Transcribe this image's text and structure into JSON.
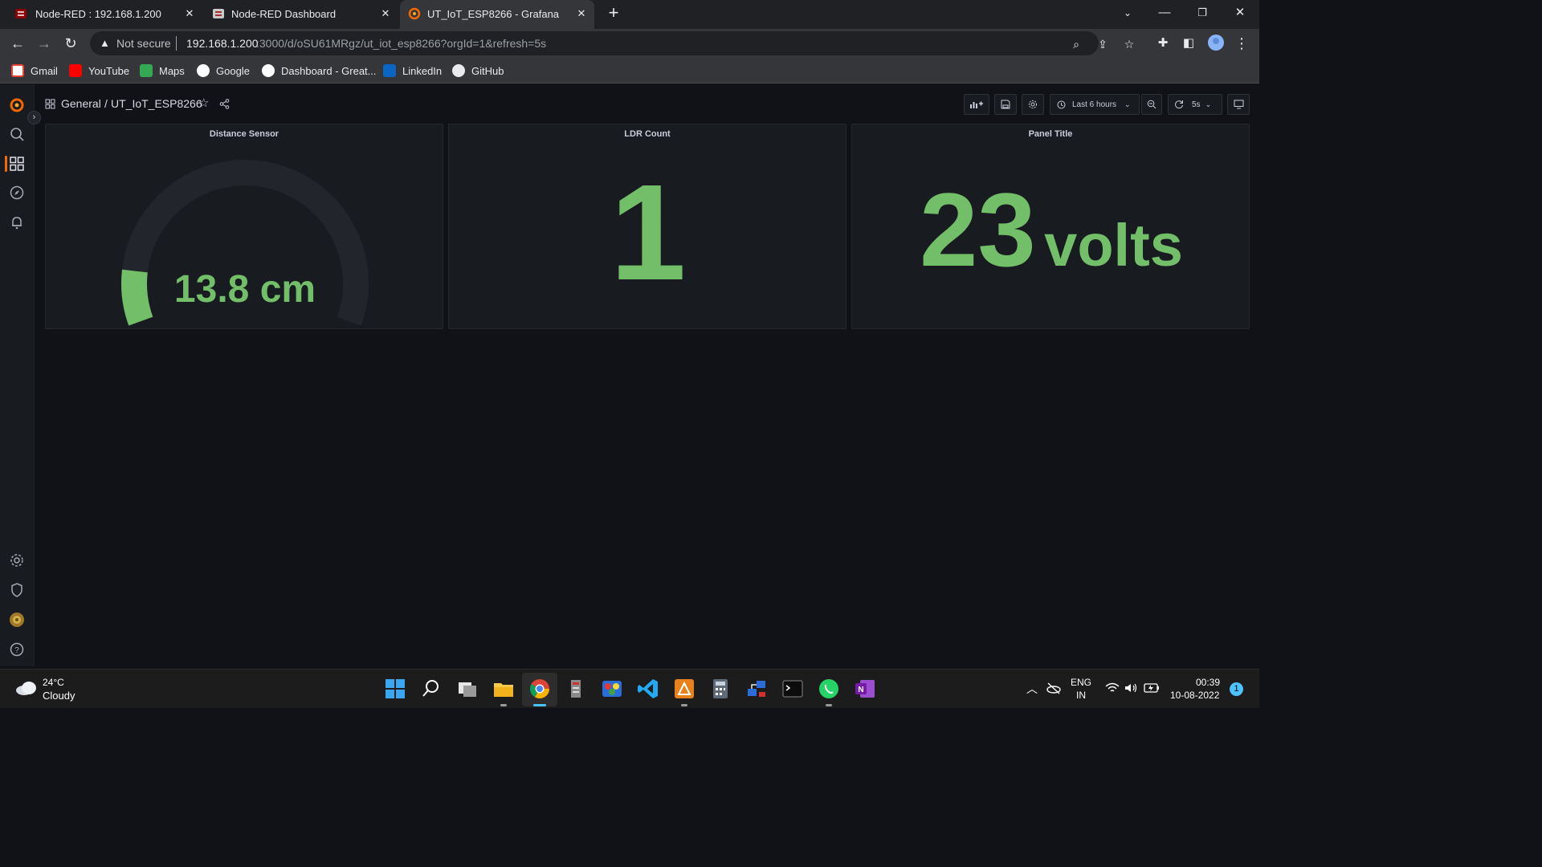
{
  "browser": {
    "tabs": [
      {
        "title": "Node-RED : 192.168.1.200",
        "active": false
      },
      {
        "title": "Node-RED Dashboard",
        "active": false
      },
      {
        "title": "UT_IoT_ESP8266 - Grafana",
        "active": true
      }
    ],
    "new_tab_symbol": "+",
    "security_label": "Not secure",
    "url_host": "192.168.1.200",
    "url_path": ":3000/d/oSU61MRgz/ut_iot_esp8266?orgId=1&refresh=5s",
    "bookmarks": [
      "Gmail",
      "YouTube",
      "Maps",
      "Google",
      "Dashboard - Great...",
      "LinkedIn",
      "GitHub"
    ]
  },
  "grafana": {
    "breadcrumb_folder": "General",
    "breadcrumb_separator": "/",
    "dashboard_title": "UT_IoT_ESP8266",
    "time_range": "Last 6 hours",
    "refresh_interval": "5s",
    "panels": {
      "distance": {
        "title": "Distance Sensor",
        "value": "13.8",
        "unit": "cm",
        "gauge_fraction": 0.12
      },
      "ldr": {
        "title": "LDR Count",
        "value": "1"
      },
      "voltage": {
        "title": "Panel Title",
        "value": "23",
        "unit": "volts"
      }
    },
    "accent_color": "#73bf69",
    "gauge_track_color": "#22252b"
  },
  "taskbar": {
    "weather_temp": "24°C",
    "weather_desc": "Cloudy",
    "lang_line1": "ENG",
    "lang_line2": "IN",
    "time": "00:39",
    "date": "10-08-2022",
    "notification_count": "1"
  }
}
